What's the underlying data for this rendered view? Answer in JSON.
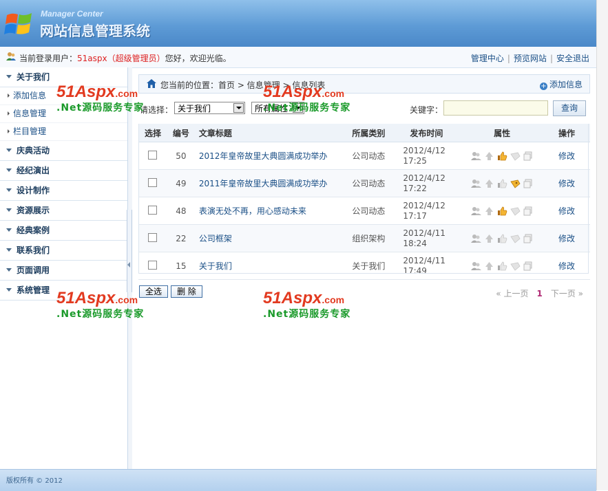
{
  "header": {
    "logo_en": "Manager Center",
    "logo_cn": "网站信息管理系统"
  },
  "topbar": {
    "greet_prefix": "当前登录用户：",
    "username": "51aspx（超级管理员）",
    "greet_suffix": "您好，欢迎光临。",
    "links": [
      "管理中心",
      "预览网站",
      "安全退出"
    ],
    "sep": "|"
  },
  "sidebar": {
    "groups": [
      {
        "label": "关于我们",
        "items": [
          "添加信息",
          "信息管理",
          "栏目管理"
        ]
      },
      {
        "label": "庆典活动",
        "items": []
      },
      {
        "label": "经纪演出",
        "items": []
      },
      {
        "label": "设计制作",
        "items": []
      },
      {
        "label": "资源展示",
        "items": []
      },
      {
        "label": "经典案例",
        "items": []
      },
      {
        "label": "联系我们",
        "items": []
      },
      {
        "label": "页面调用",
        "items": []
      },
      {
        "label": "系统管理",
        "items": []
      }
    ]
  },
  "content": {
    "crumb": "您当前的位置：首页 > 信息管理 > 信息列表",
    "add_label": "添加信息",
    "filter_label": "请选择：",
    "select_category": "关于我们",
    "select_attr": "所有属性",
    "keyword_label": "关键字：",
    "keyword_value": "",
    "query_label": "查询"
  },
  "table": {
    "headers": [
      "选择",
      "编号",
      "文章标题",
      "所属类别",
      "发布时间",
      "属性",
      "操作"
    ],
    "rows": [
      {
        "id": "50",
        "title": "2012年皇帝故里大典圆满成功举办",
        "category": "公司动态",
        "date": "2012/4/12",
        "time": "17:25",
        "edit": "修改"
      },
      {
        "id": "49",
        "title": "2011年皇帝故里大典圆满成功举办",
        "category": "公司动态",
        "date": "2012/4/12",
        "time": "17:22",
        "edit": "修改"
      },
      {
        "id": "48",
        "title": "表演无处不再，用心感动未来",
        "category": "公司动态",
        "date": "2012/4/12",
        "time": "17:17",
        "edit": "修改"
      },
      {
        "id": "22",
        "title": "公司框架",
        "category": "组织架构",
        "date": "2012/4/11",
        "time": "18:24",
        "edit": "修改"
      },
      {
        "id": "15",
        "title": "关于我们",
        "category": "关于我们",
        "date": "2012/4/11",
        "time": "17:49",
        "edit": "修改"
      }
    ],
    "attr_icons": [
      "users-icon",
      "top-arrow-icon",
      "thumb-up-icon",
      "recommend-icon",
      "copy-icon"
    ]
  },
  "footer_actions": {
    "select_all": "全选",
    "delete": "删 除"
  },
  "pager": {
    "prev": "« 上一页",
    "current": "1",
    "next": "下一页 »"
  },
  "footer": {
    "copyright": "版权所有 © 2012"
  },
  "watermark": {
    "brand": "51Aspx",
    "domain": ".com",
    "slogan": ".Net源码服务专家"
  },
  "colors": {
    "header_blue": "#5e9bd6",
    "link": "#1a4f86",
    "username_red": "#dd2222",
    "pager_current": "#b02a74"
  }
}
